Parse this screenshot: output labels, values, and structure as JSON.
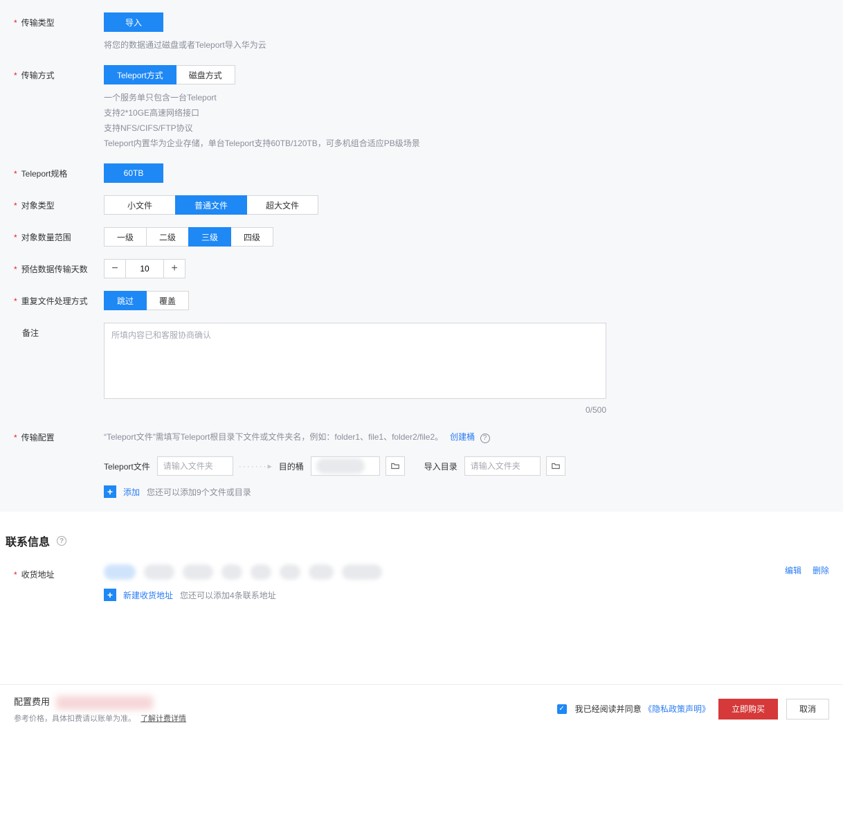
{
  "form": {
    "transmitType": {
      "label": "传输类型",
      "options": [
        "导入"
      ],
      "selected": 0,
      "desc": "将您的数据通过磁盘或者Teleport导入华为云"
    },
    "transmitMode": {
      "label": "传输方式",
      "options": [
        "Teleport方式",
        "磁盘方式"
      ],
      "selected": 0,
      "desc": [
        "一个服务单只包含一台Teleport",
        "支持2*10GE高速网络接口",
        "支持NFS/CIFS/FTP协议",
        "Teleport内置华为企业存储，单台Teleport支持60TB/120TB，可多机组合适应PB级场景"
      ]
    },
    "teleportSpec": {
      "label": "Teleport规格",
      "options": [
        "60TB"
      ],
      "selected": 0
    },
    "objectType": {
      "label": "对象类型",
      "options": [
        "小文件",
        "普通文件",
        "超大文件"
      ],
      "selected": 1
    },
    "objectCount": {
      "label": "对象数量范围",
      "options": [
        "一级",
        "二级",
        "三级",
        "四级"
      ],
      "selected": 2
    },
    "estimateDays": {
      "label": "预估数据传输天数",
      "value": "10"
    },
    "duplicate": {
      "label": "重复文件处理方式",
      "options": [
        "跳过",
        "覆盖"
      ],
      "selected": 0
    },
    "notes": {
      "label": "备注",
      "placeholder": "所填内容已和客服协商确认",
      "counter": "0/500"
    },
    "transferConfig": {
      "label": "传输配置",
      "desc": "“Teleport文件”需填写Teleport根目录下文件或文件夹名，例如：folder1、file1、folder2/file2。",
      "createBucket": "创建桶",
      "fields": {
        "teleportFile": {
          "label": "Teleport文件",
          "placeholder": "请输入文件夹"
        },
        "destBucket": {
          "label": "目的桶"
        },
        "importDir": {
          "label": "导入目录",
          "placeholder": "请输入文件夹"
        }
      },
      "add": {
        "text": "添加",
        "hint": "您还可以添加9个文件或目录"
      }
    }
  },
  "contact": {
    "title": "联系信息",
    "address": {
      "label": "收货地址",
      "edit": "编辑",
      "delete": "删除",
      "newAddress": "新建收货地址",
      "hint": "您还可以添加4条联系地址"
    }
  },
  "footer": {
    "feeLabel": "配置费用",
    "feeDesc": "参考价格，具体扣费请以账单为准。",
    "billingLink": "了解计费详情",
    "agree": "我已经阅读并同意",
    "policy": "《隐私政策声明》",
    "buy": "立即购买",
    "cancel": "取消"
  }
}
